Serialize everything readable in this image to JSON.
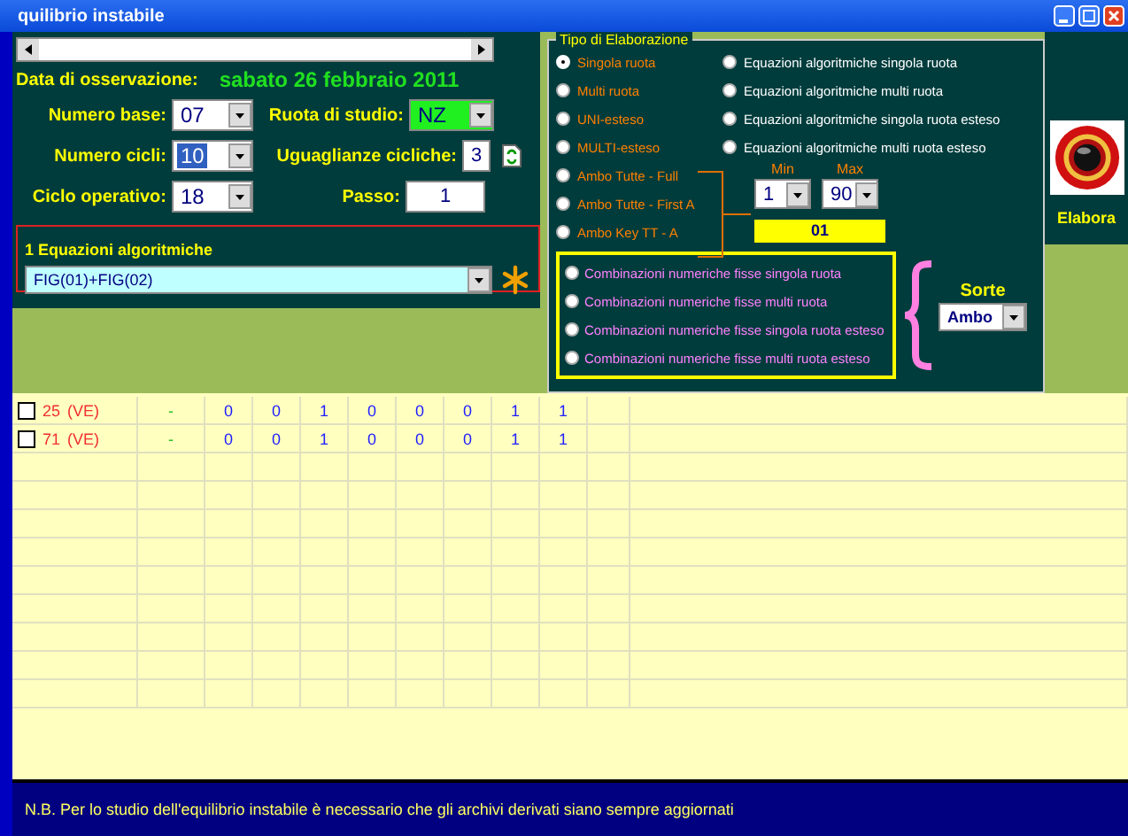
{
  "window": {
    "title": "quilibrio instabile"
  },
  "observation": {
    "label": "Data di osservazione:",
    "value": "sabato 26 febbraio 2011"
  },
  "fields": {
    "numero_base": {
      "label": "Numero base:",
      "value": "07"
    },
    "ruota": {
      "label": "Ruota di studio:",
      "value": "NZ"
    },
    "numero_cicli": {
      "label": "Numero cicli:",
      "value": "10",
      "selected": true
    },
    "uguaglianze": {
      "label": "Uguaglianze cicliche:",
      "value": "3"
    },
    "ciclo": {
      "label": "Ciclo operativo:",
      "value": "18"
    },
    "passo": {
      "label": "Passo:",
      "value": "1"
    }
  },
  "equazioni": {
    "label": "1 Equazioni algoritmiche",
    "value": "FIG(01)+FIG(02)"
  },
  "tipo": {
    "title": "Tipo di Elaborazione",
    "left_options": [
      {
        "label": "Singola ruota",
        "selected": true
      },
      {
        "label": "Multi ruota",
        "selected": false
      },
      {
        "label": "UNI-esteso",
        "selected": false
      },
      {
        "label": "MULTI-esteso",
        "selected": false
      },
      {
        "label": "Ambo Tutte - Full",
        "selected": false
      },
      {
        "label": "Ambo Tutte - First A",
        "selected": false
      },
      {
        "label": "Ambo Key TT -  A",
        "selected": false
      }
    ],
    "right_options": [
      {
        "label": "Equazioni algoritmiche singola ruota",
        "selected": false
      },
      {
        "label": "Equazioni algoritmiche multi ruota",
        "selected": false
      },
      {
        "label": "Equazioni algoritmiche singola ruota esteso",
        "selected": false
      },
      {
        "label": "Equazioni algoritmiche multi ruota esteso",
        "selected": false
      }
    ],
    "min": {
      "label": "Min",
      "value": "1"
    },
    "max": {
      "label": "Max",
      "value": "90"
    },
    "key_value": "01",
    "combinazioni": [
      {
        "label": "Combinazioni numeriche fisse singola ruota",
        "selected": false
      },
      {
        "label": "Combinazioni numeriche fisse multi ruota",
        "selected": false
      },
      {
        "label": "Combinazioni numeriche fisse singola ruota esteso",
        "selected": false
      },
      {
        "label": "Combinazioni numeriche fisse multi ruota esteso",
        "selected": false
      }
    ],
    "sorte": {
      "label": "Sorte",
      "value": "Ambo"
    }
  },
  "elabora": {
    "label": "Elabora"
  },
  "rows": [
    {
      "checked": false,
      "number": "25",
      "wheel": "(VE)",
      "dash": "-",
      "values": [
        "0",
        "0",
        "1",
        "0",
        "0",
        "0",
        "1",
        "1"
      ]
    },
    {
      "checked": false,
      "number": "71",
      "wheel": "(VE)",
      "dash": "-",
      "values": [
        "0",
        "0",
        "1",
        "0",
        "0",
        "0",
        "1",
        "1"
      ]
    }
  ],
  "note": "N.B. Per lo studio dell'equilibrio instabile è necessario che gli archivi derivati siano sempre aggiornati"
}
